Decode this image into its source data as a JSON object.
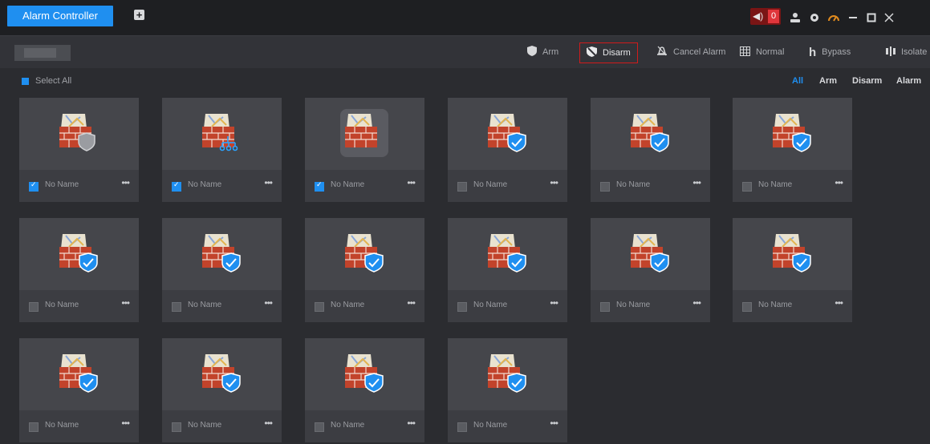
{
  "titlebar": {
    "active_tab": "Alarm Controller",
    "add_tab_icon": "plus-box-icon",
    "alarm_count": "0",
    "icons": [
      "speaker-icon",
      "user-icon",
      "gear-icon",
      "gauge-icon",
      "minimize-icon",
      "maximize-icon",
      "close-icon"
    ]
  },
  "toolbar": {
    "arm": "Arm",
    "disarm": "Disarm",
    "cancel_alarm": "Cancel Alarm",
    "normal": "Normal",
    "bypass": "Bypass",
    "isolate": "Isolate",
    "highlight_color": "#d11b1b"
  },
  "select_all": "Select All",
  "filters": [
    "All",
    "Arm",
    "Disarm",
    "Alarm"
  ],
  "accent_color": "#1f8ff0",
  "zones": [
    {
      "name": "No Name",
      "more": "•••",
      "checked": true,
      "status": "shield-gray"
    },
    {
      "name": "No Name",
      "more": "•••",
      "checked": true,
      "status": "bypass-tree"
    },
    {
      "name": "No Name",
      "more": "•••",
      "checked": true,
      "status": "selected"
    },
    {
      "name": "No Name",
      "more": "•••",
      "checked": false,
      "status": "shield-check"
    },
    {
      "name": "No Name",
      "more": "•••",
      "checked": false,
      "status": "shield-check"
    },
    {
      "name": "No Name",
      "more": "•••",
      "checked": false,
      "status": "shield-check"
    },
    {
      "name": "No Name",
      "more": "•••",
      "checked": false,
      "status": "shield-check"
    },
    {
      "name": "No Name",
      "more": "•••",
      "checked": false,
      "status": "shield-check"
    },
    {
      "name": "No Name",
      "more": "•••",
      "checked": false,
      "status": "shield-check"
    },
    {
      "name": "No Name",
      "more": "•••",
      "checked": false,
      "status": "shield-check"
    },
    {
      "name": "No Name",
      "more": "•••",
      "checked": false,
      "status": "shield-check"
    },
    {
      "name": "No Name",
      "more": "•••",
      "checked": false,
      "status": "shield-check"
    },
    {
      "name": "No Name",
      "more": "•••",
      "checked": false,
      "status": "shield-check"
    },
    {
      "name": "No Name",
      "more": "•••",
      "checked": false,
      "status": "shield-check"
    },
    {
      "name": "No Name",
      "more": "•••",
      "checked": false,
      "status": "shield-check"
    },
    {
      "name": "No Name",
      "more": "•••",
      "checked": false,
      "status": "shield-check"
    }
  ]
}
